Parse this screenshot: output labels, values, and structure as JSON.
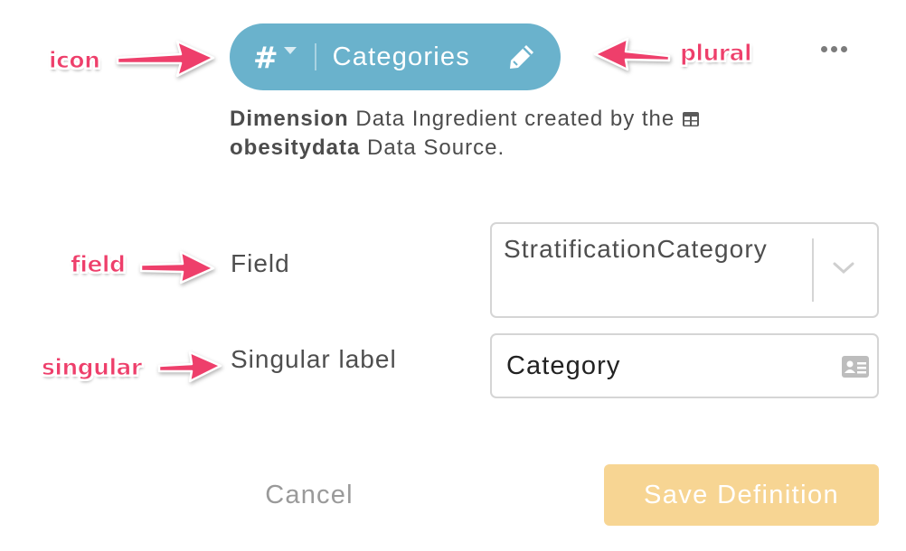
{
  "annotations": {
    "icon": "icon",
    "plural": "plural",
    "field": "field",
    "singular": "singular"
  },
  "header": {
    "icon_symbol": "#",
    "title": "Categories",
    "pill_color": "#6ab2cc"
  },
  "description": {
    "part1_bold": "Dimension",
    "part2": " Data Ingredient created by the ",
    "source_bold": "obesitydata",
    "part3": " Data Source."
  },
  "form": {
    "field_label": "Field",
    "field_value": "StratificationCategory",
    "singular_label": "Singular label",
    "singular_value": "Category"
  },
  "footer": {
    "cancel_label": "Cancel",
    "save_label": "Save Definition",
    "save_color": "#f7d593"
  },
  "colors": {
    "annotation": "#ee3f6b"
  }
}
